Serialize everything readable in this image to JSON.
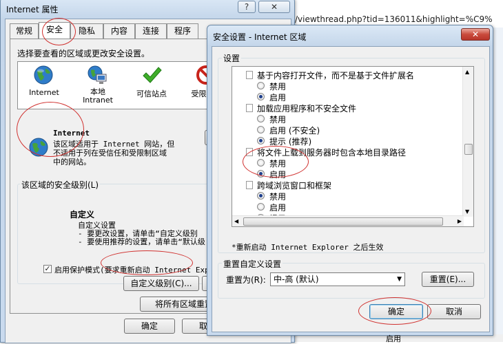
{
  "background": {
    "url_text": "/viewthread.php?tid=136011&highlight=%C9%",
    "partial_label": "启用"
  },
  "internet_props": {
    "title": "Internet 属性",
    "help_label": "?",
    "close_label": "✕",
    "tabs": [
      "常规",
      "安全",
      "隐私",
      "内容",
      "连接",
      "程序"
    ],
    "instruction": "选择要查看的区域或更改安全设置。",
    "zones": [
      {
        "icon": "globe-icon",
        "label": "Internet"
      },
      {
        "icon": "computer-icon",
        "label": "本地\nIntranet"
      },
      {
        "icon": "checkmark-icon",
        "label": "可信站点"
      },
      {
        "icon": "restricted-icon",
        "label": "受限站"
      }
    ],
    "zone_title": "Internet",
    "zone_desc": "该区域适用于 Internet 网站，但\n不适用于列在受信任和受限制区域\n中的网站。",
    "level_group_label": "该区域的安全级别(L)",
    "level_name": "自定义",
    "level_lines": [
      "自定义设置",
      "- 要更改设置，请单击“自定义级别",
      "- 要使用推荐的设置，请单击“默认级"
    ],
    "protected_mode": "启用保护模式(要求重新启动 Internet Explo",
    "protected_mode_checked": true,
    "custom_level_button": "自定义级别(C)...",
    "reset_all_button": "将所有区域重置为",
    "ok_button": "确定",
    "cancel_button": "取消"
  },
  "security_settings": {
    "title": "安全设置 - Internet 区域",
    "close_label": "✕",
    "settings_group_label": "设置",
    "items": [
      {
        "type": "heading",
        "label": "基于内容打开文件，而不是基于文件扩展名"
      },
      {
        "type": "option",
        "label": "禁用",
        "checked": false
      },
      {
        "type": "option",
        "label": "启用",
        "checked": true
      },
      {
        "type": "heading",
        "label": "加载应用程序和不安全文件"
      },
      {
        "type": "option",
        "label": "禁用",
        "checked": false
      },
      {
        "type": "option",
        "label": "启用 (不安全)",
        "checked": false
      },
      {
        "type": "option",
        "label": "提示 (推荐)",
        "checked": true
      },
      {
        "type": "heading",
        "label": "将文件上载到服务器时包含本地目录路径"
      },
      {
        "type": "option",
        "label": "禁用",
        "checked": false
      },
      {
        "type": "option",
        "label": "启用",
        "checked": true
      },
      {
        "type": "heading",
        "label": "跨域浏览窗口和框架"
      },
      {
        "type": "option",
        "label": "禁用",
        "checked": true
      },
      {
        "type": "option",
        "label": "启用",
        "checked": false
      },
      {
        "type": "option",
        "label": "提示",
        "checked": false
      }
    ],
    "restart_note": "*重新启动 Internet Explorer 之后生效",
    "reset_group_label": "重置自定义设置",
    "reset_to_label": "重置为(R):",
    "reset_select_value": "中-高 (默认)",
    "reset_button": "重置(E)...",
    "ok_button": "确定",
    "cancel_button": "取消"
  }
}
